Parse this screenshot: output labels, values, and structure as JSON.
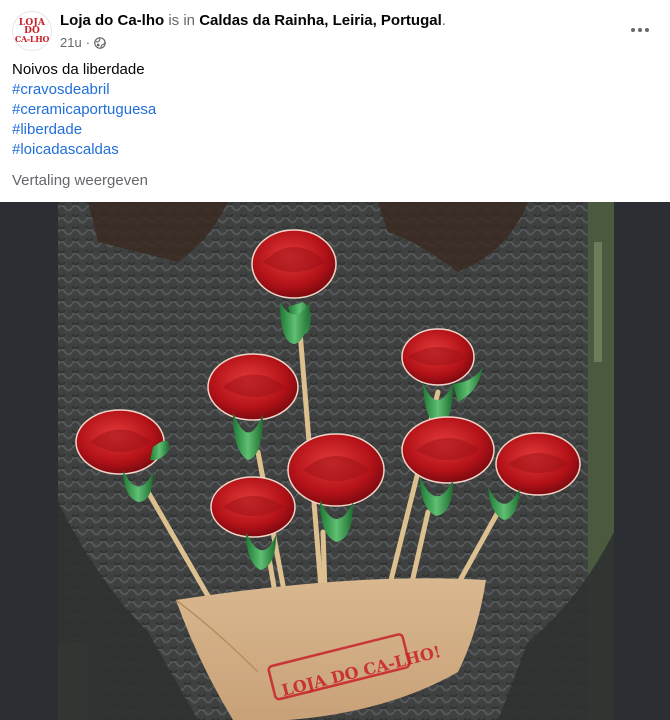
{
  "post": {
    "author": "Loja do Ca-lho",
    "connector": "is in",
    "location": "Caldas da Rainha, Leiria, Portugal",
    "location_suffix": ".",
    "timestamp": "21u",
    "separator": "·",
    "privacy_icon": "globe-icon",
    "more_icon": "more-horizontal-icon",
    "avatar_lines": [
      "LOJA",
      "DO",
      "CA-LHO"
    ],
    "text": "Noivos da liberdade",
    "hashtags": [
      "#cravosdeabril",
      "#ceramicaportuguesa",
      "#liberdade",
      "#loicadascaldas"
    ],
    "translate_label": "Vertaling weergeven"
  },
  "photo": {
    "stamp_text": "LOJA DO CA-LHO!"
  },
  "colors": {
    "link": "#216fdb",
    "secondary_text": "#65676b",
    "media_background": "#2b2f33",
    "brand_red": "#c8202a"
  }
}
